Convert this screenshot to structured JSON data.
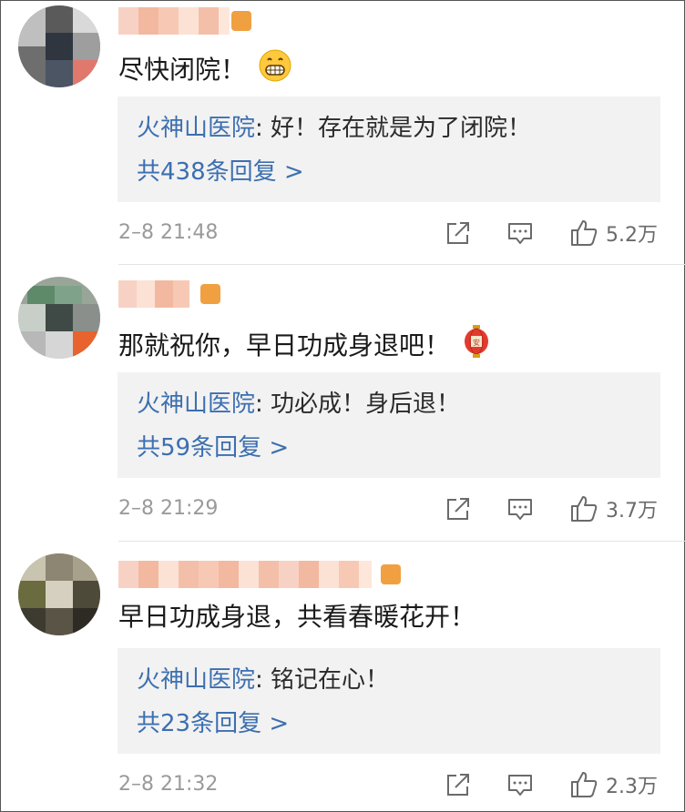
{
  "comments": [
    {
      "text": "尽快闭院！",
      "emoji": "grinning-face-icon",
      "reply_author": "火神山医院",
      "reply_text": ": 好！存在就是为了闭院！",
      "more_replies": "共438条回复 >",
      "date": "2–8 21:48",
      "likes": "5.2万"
    },
    {
      "text": "那就祝你，早日功成身退吧！",
      "emoji": "lantern-icon",
      "reply_author": "火神山医院",
      "reply_text": ": 功必成！身后退！",
      "more_replies": "共59条回复 >",
      "date": "2–8 21:29",
      "likes": "3.7万"
    },
    {
      "text": "早日功成身退，共看春暖花开！",
      "emoji": "",
      "reply_author": "火神山医院",
      "reply_text": ": 铭记在心！",
      "more_replies": "共23条回复 >",
      "date": "2–8 21:32",
      "likes": "2.3万"
    }
  ],
  "colors": {
    "link_blue": "#3c6fb0",
    "reply_bg": "#f2f2f2",
    "meta_gray": "#9a9a9a"
  },
  "icons": {
    "share": "share-icon",
    "comment": "comment-icon",
    "like": "thumbs-up-icon"
  }
}
